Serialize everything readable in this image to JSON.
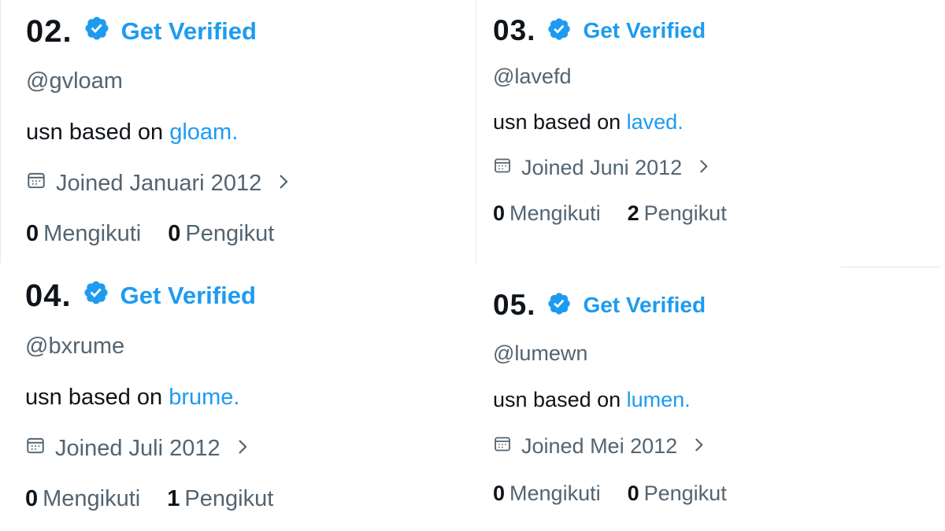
{
  "colors": {
    "accent": "#1d9bf0",
    "text_primary": "#0f1419",
    "text_secondary": "#536471"
  },
  "icons": {
    "badge": "verified-badge-icon",
    "calendar": "calendar-icon",
    "chevron": "chevron-right-icon"
  },
  "profiles": [
    {
      "number": "02.",
      "get_verified": "Get Verified",
      "handle": "@gvloam",
      "bio_prefix": "usn based on ",
      "bio_link": "gloam.",
      "joined": "Joined Januari 2012",
      "following_count": "0",
      "following_label": "Mengikuti",
      "followers_count": "0",
      "followers_label": "Pengikut"
    },
    {
      "number": "03.",
      "get_verified": "Get Verified",
      "handle": "@lavefd",
      "bio_prefix": "usn based on ",
      "bio_link": "laved.",
      "joined": "Joined Juni 2012",
      "following_count": "0",
      "following_label": "Mengikuti",
      "followers_count": "2",
      "followers_label": "Pengikut"
    },
    {
      "number": "04.",
      "get_verified": "Get Verified",
      "handle": "@bxrume",
      "bio_prefix": "usn based on ",
      "bio_link": "brume.",
      "joined": "Joined Juli 2012",
      "following_count": "0",
      "following_label": "Mengikuti",
      "followers_count": "1",
      "followers_label": "Pengikut"
    },
    {
      "number": "05.",
      "get_verified": "Get Verified",
      "handle": "@lumewn",
      "bio_prefix": "usn based on ",
      "bio_link": "lumen.",
      "joined": "Joined Mei 2012",
      "following_count": "0",
      "following_label": "Mengikuti",
      "followers_count": "0",
      "followers_label": "Pengikut"
    }
  ]
}
